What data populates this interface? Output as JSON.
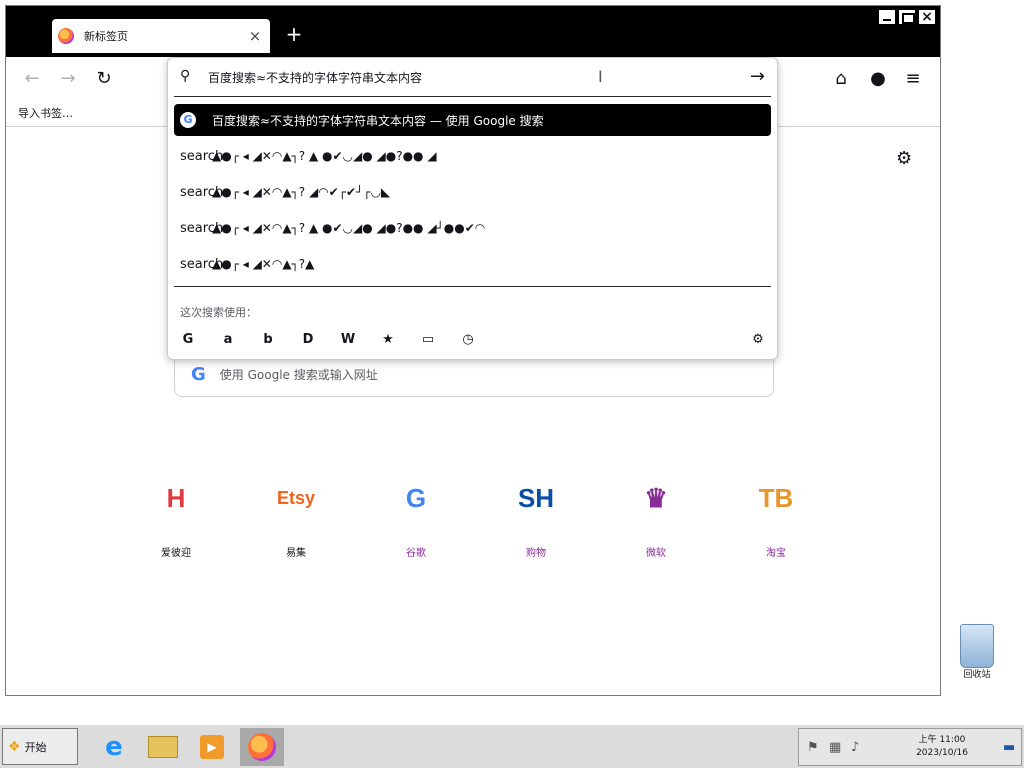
{
  "window": {
    "tab_title": "新标签页",
    "tab_close": "×",
    "new_tab": "+",
    "controls": {
      "minimize": "",
      "maximize": "",
      "close": "×"
    }
  },
  "nav": {
    "back": "←",
    "forward": "→",
    "reload": "↻",
    "pocket": "⌂",
    "account": "●",
    "menu": "≡"
  },
  "bookmarks": {
    "import_label": "导入书签…"
  },
  "urlbar": {
    "text": "百度搜索≈不支持的字体字符串文本内容",
    "go": "→",
    "results": [
      {
        "text": "百度搜索≈不支持的字体字符串文本内容  — 使用 Google 搜索",
        "icon": "G",
        "selected": true
      },
      {
        "text": "▲●┌ ◂ ◢✕◠▲┐? ▲ ●✔◡◢● ◢●?●● ◢",
        "icon": "search",
        "selected": false
      },
      {
        "text": "▲●┌ ◂ ◢✕◠▲┐? ◢◠✔┌✔┘┌◡◣",
        "icon": "search",
        "selected": false
      },
      {
        "text": "▲●┌ ◂ ◢✕◠▲┐? ▲ ●✔◡◢● ◢●?●● ◢┘●●✔◠",
        "icon": "search",
        "selected": false
      },
      {
        "text": "▲●┌ ◂ ◢✕◠▲┐?▲",
        "icon": "search",
        "selected": false
      }
    ],
    "oneoff_label": "这次搜索使用：",
    "engines": [
      "G",
      "a",
      "b",
      "D",
      "W",
      "★",
      "▭",
      "◷"
    ],
    "settings": "⚙"
  },
  "content": {
    "settings_icon": "⚙",
    "search_placeholder": "使用 Google 搜索或输入网址",
    "tiles": [
      {
        "name": "H",
        "label": "爱彼迎",
        "color": "#e03a3e"
      },
      {
        "name": "Etsy",
        "label": "易集",
        "color": "#f1641e"
      },
      {
        "name": "G",
        "label": "谷歌",
        "color": "#4285f4"
      },
      {
        "name": "SH",
        "label": "购物",
        "color": "#0a4ea5"
      },
      {
        "name": "♛",
        "label": "微软",
        "color": "#8a2b9a"
      },
      {
        "name": "TB",
        "label": "淘宝",
        "color": "#e8952c"
      }
    ]
  },
  "taskbar": {
    "start_label": "开始",
    "clock_time": "上午 11:00",
    "clock_date": "2023/10/16"
  },
  "desktop": {
    "recycle_label": "回收站"
  }
}
